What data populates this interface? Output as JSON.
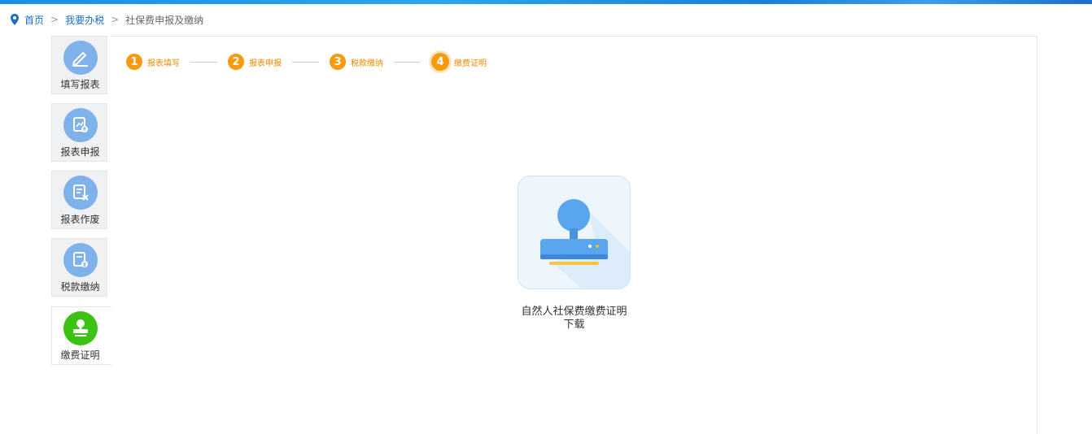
{
  "breadcrumb": {
    "home": "首页",
    "level2": "我要办税",
    "current": "社保费申报及缴纳",
    "separator": ">"
  },
  "sidebar": {
    "items": [
      {
        "label": "填写报表",
        "icon": "pencil-icon"
      },
      {
        "label": "报表申报",
        "icon": "report-upload-icon"
      },
      {
        "label": "报表作废",
        "icon": "report-void-icon"
      },
      {
        "label": "税款缴纳",
        "icon": "tax-payment-icon"
      },
      {
        "label": "缴费证明",
        "icon": "stamp-icon",
        "active": true
      }
    ]
  },
  "steps": [
    {
      "num": "1",
      "label": "报表填写"
    },
    {
      "num": "2",
      "label": "报表申报"
    },
    {
      "num": "3",
      "label": "税款缴纳"
    },
    {
      "num": "4",
      "label": "缴费证明",
      "current": true
    }
  ],
  "download": {
    "caption_line1": "自然人社保费缴费证明",
    "caption_line2": "下载",
    "icon": "stamp-icon"
  },
  "colors": {
    "accent_orange": "#f89a0e",
    "link_blue": "#1d6fbf",
    "sidebar_icon_blue": "#7fb1ea",
    "active_green": "#3cc213"
  }
}
